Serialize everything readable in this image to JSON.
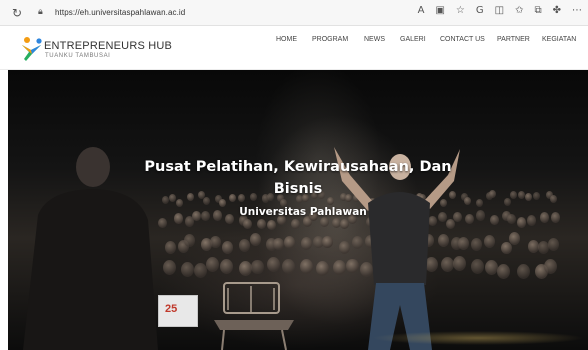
{
  "browser": {
    "url": "https://eh.universitaspahlawan.ac.id",
    "reload_icon": "reload-icon",
    "lock_icon": "lock-icon",
    "toolbar_icons": [
      "read-aloud-icon",
      "reader-view-icon",
      "favorite-star-icon",
      "copilot-icon",
      "split-screen-icon",
      "favorites-icon",
      "collections-icon",
      "extensions-icon",
      "more-icon"
    ]
  },
  "site": {
    "logo_title": "ENTREPRENEURS HUB",
    "logo_subtitle": "TUANKU TAMBUSAI",
    "nav": [
      "HOME",
      "PROGRAM",
      "NEWS",
      "GALERI",
      "CONTACT US",
      "PARTNER",
      "KEGIATAN"
    ]
  },
  "hero": {
    "title": "Pusat Pelatihan, Kewirausahaan, Dan Bisnis",
    "subtitle": "Universitas Pahlawan",
    "sign_text": "25"
  },
  "colors": {
    "logo_orange": "#f39c12",
    "logo_blue": "#2e86de",
    "logo_green": "#27ae60",
    "hero_text": "#ffffff"
  }
}
